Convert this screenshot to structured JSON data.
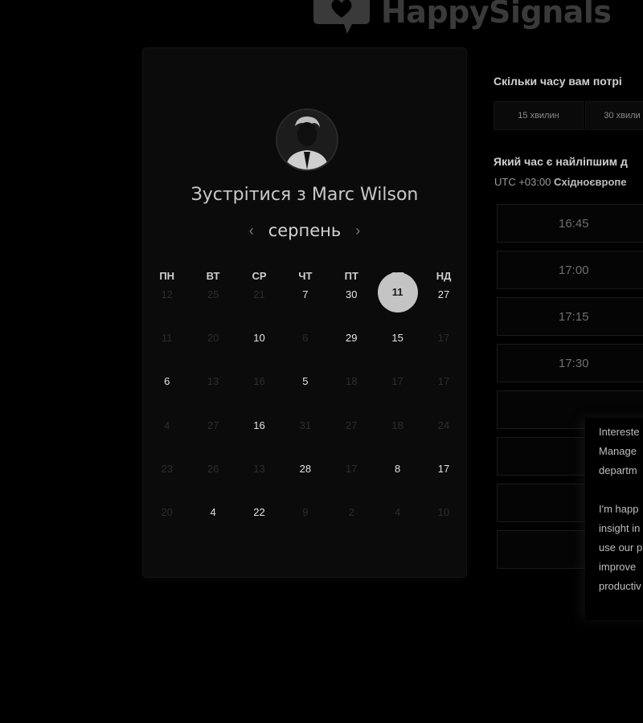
{
  "logo": {
    "text": "HappySignals",
    "icon": "speech-bubble-heart-icon"
  },
  "card": {
    "avatar": "person-avatar",
    "title_prefix": "Зустрітися з ",
    "host_name": "Marc Wilson",
    "month": "серпень",
    "prev_icon": "‹",
    "next_icon": "›",
    "weekdays": [
      "ПН",
      "ВТ",
      "СР",
      "ЧТ",
      "ПТ",
      "СБ",
      "НД"
    ],
    "rows": [
      [
        "12",
        "25",
        "21",
        "7",
        "30",
        "11",
        "27"
      ],
      [
        "11",
        "20",
        "10",
        "6",
        "29",
        "15",
        "17"
      ],
      [
        "6",
        "13",
        "16",
        "5",
        "18",
        "17",
        "17"
      ],
      [
        "4",
        "27",
        "16",
        "31",
        "27",
        "18",
        "24"
      ],
      [
        "23",
        "26",
        "13",
        "28",
        "17",
        "8",
        "17"
      ],
      [
        "20",
        "4",
        "22",
        "9",
        "2",
        "4",
        "10"
      ]
    ],
    "available": [
      [
        false,
        false,
        false,
        true,
        true,
        true,
        true
      ],
      [
        false,
        false,
        true,
        false,
        true,
        true,
        false
      ],
      [
        true,
        false,
        false,
        true,
        false,
        false,
        false
      ],
      [
        false,
        false,
        true,
        false,
        false,
        false,
        false
      ],
      [
        false,
        false,
        false,
        true,
        false,
        true,
        true
      ],
      [
        false,
        true,
        true,
        false,
        false,
        false,
        false
      ]
    ],
    "selected": [
      0,
      5
    ]
  },
  "right": {
    "duration_question": "Скільки часу вам потрі",
    "durations": [
      "15 хвилин",
      "30 хвили"
    ],
    "time_question": "Який час є найліпшим д",
    "timezone_offset": "UTC +03:00 ",
    "timezone_name": "Східноєвропе",
    "slots": [
      "16:45",
      "17:00",
      "17:15",
      "17:30",
      "",
      "",
      "",
      ""
    ]
  },
  "popup": {
    "lines": [
      "Intereste",
      "Manage",
      "departm",
      "",
      "I'm happ",
      "insight in",
      "use our p",
      "improve",
      "productiv"
    ]
  }
}
